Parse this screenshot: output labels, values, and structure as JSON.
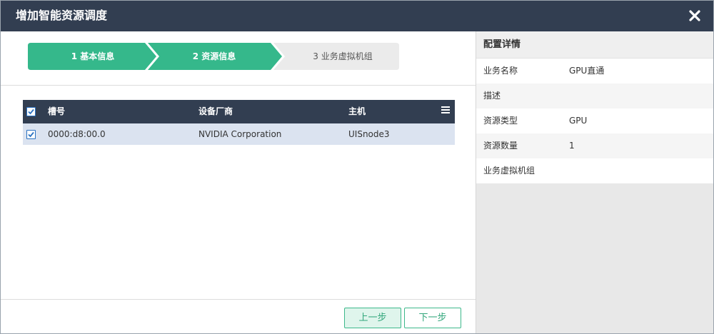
{
  "dialog": {
    "title": "增加智能资源调度"
  },
  "steps": [
    {
      "label": "1 基本信息",
      "state": "done"
    },
    {
      "label": "2 资源信息",
      "state": "active"
    },
    {
      "label": "3 业务虚拟机组",
      "state": "pending"
    }
  ],
  "colors": {
    "header_bg": "#323e51",
    "step_active": "#35b88b",
    "step_pending": "#ebebeb",
    "row_selected": "#dbe3f0",
    "accent_green": "#31a67b"
  },
  "table": {
    "columns": [
      "槽号",
      "设备厂商",
      "主机"
    ],
    "rows": [
      {
        "slot": "0000:d8:00.0",
        "vendor": "NVIDIA Corporation",
        "host": "UISnode3",
        "checked": true
      }
    ],
    "header_checked": true
  },
  "footer": {
    "prev_label": "上一步",
    "next_label": "下一步"
  },
  "details": {
    "heading": "配置详情",
    "items": [
      {
        "key": "业务名称",
        "value": "GPU直通"
      },
      {
        "key": "描述",
        "value": ""
      },
      {
        "key": "资源类型",
        "value": "GPU"
      },
      {
        "key": "资源数量",
        "value": "1"
      },
      {
        "key": "业务虚拟机组",
        "value": ""
      }
    ]
  },
  "icons": {
    "close": "close-icon",
    "column_menu": "menu-icon",
    "checkbox": "checkbox-checked-icon"
  }
}
